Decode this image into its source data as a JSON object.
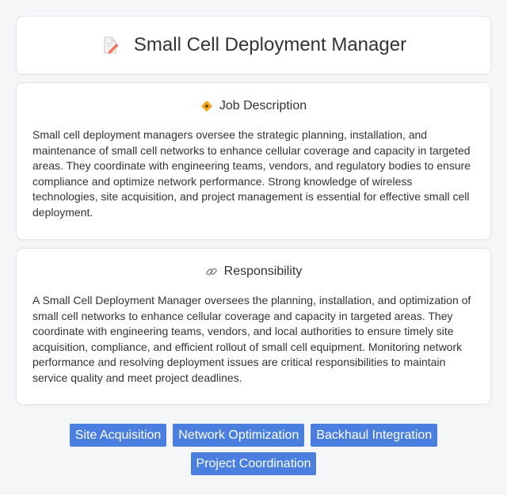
{
  "header": {
    "title": "Small Cell Deployment Manager",
    "icon": "document-pencil-icon"
  },
  "job_description": {
    "heading": "Job Description",
    "icon": "diamond-icon",
    "text": "Small cell deployment managers oversee the strategic planning, installation, and maintenance of small cell networks to enhance cellular coverage and capacity in targeted areas. They coordinate with engineering teams, vendors, and regulatory bodies to ensure compliance and optimize network performance. Strong knowledge of wireless technologies, site acquisition, and project management is essential for effective small cell deployment."
  },
  "responsibility": {
    "heading": "Responsibility",
    "icon": "link-icon",
    "text": "A Small Cell Deployment Manager oversees the planning, installation, and optimization of small cell networks to enhance cellular coverage and capacity in targeted areas. They coordinate with engineering teams, vendors, and local authorities to ensure timely site acquisition, compliance, and efficient rollout of small cell equipment. Monitoring network performance and resolving deployment issues are critical responsibilities to maintain service quality and meet project deadlines."
  },
  "tags": [
    "Site Acquisition",
    "Network Optimization",
    "Backhaul Integration",
    "Project Coordination"
  ],
  "colors": {
    "tag_bg": "#4a7fe0",
    "page_bg": "#f5f6f8"
  }
}
